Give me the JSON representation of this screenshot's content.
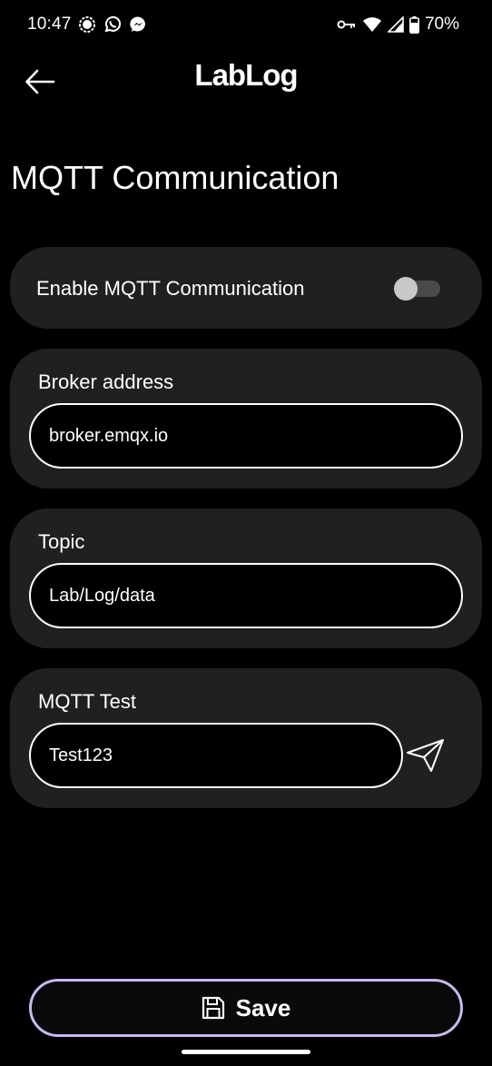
{
  "status_bar": {
    "time": "10:47",
    "battery": "70%",
    "left_icons": [
      "signal-messenger-icon",
      "whatsapp-icon",
      "messenger-icon"
    ],
    "right_icons": [
      "vpn-key-icon",
      "wifi-icon",
      "cell-signal-icon",
      "battery-icon"
    ]
  },
  "app_bar": {
    "title": "LabLog",
    "back_icon": "arrow-left-icon"
  },
  "page": {
    "title": "MQTT Communication"
  },
  "mqtt_toggle": {
    "label": "Enable MQTT Communication",
    "enabled": false
  },
  "broker": {
    "label": "Broker address",
    "value": "broker.emqx.io"
  },
  "topic": {
    "label": "Topic",
    "value": "Lab/Log/data"
  },
  "mqtt_test": {
    "label": "MQTT Test",
    "value": "Test123",
    "send_icon": "send-icon"
  },
  "save_button": {
    "label": "Save",
    "icon": "floppy-disk-icon"
  },
  "colors": {
    "background": "#000000",
    "card": "#202020",
    "save_border": "#c9b8ee",
    "text": "#ffffff"
  }
}
